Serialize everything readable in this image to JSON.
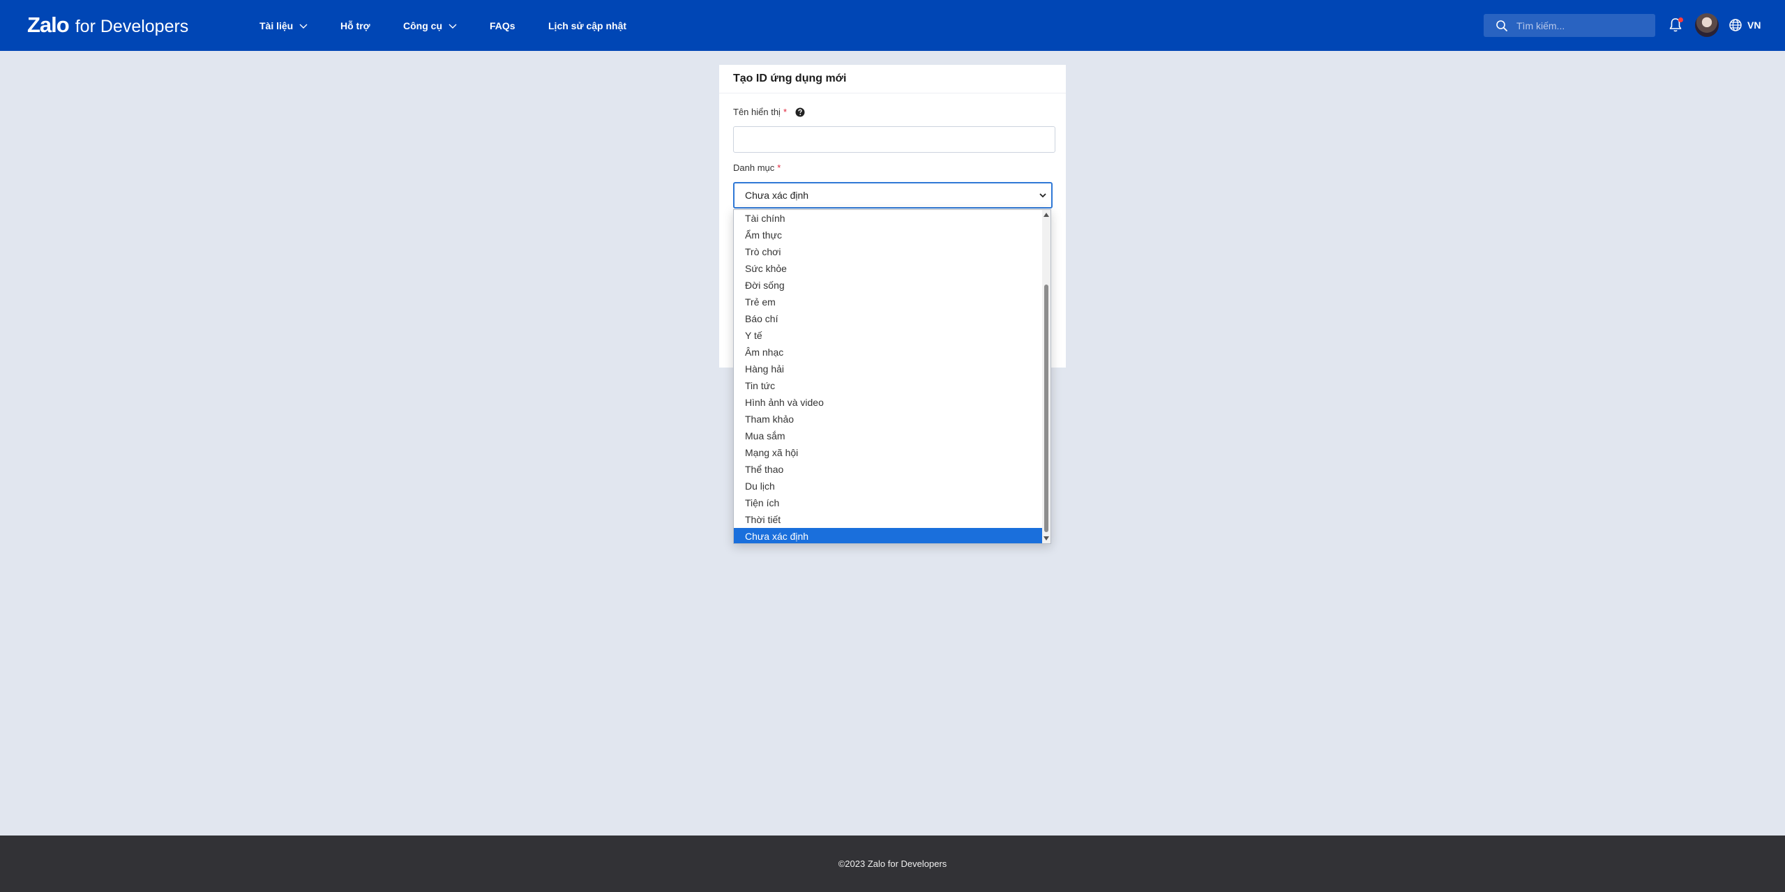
{
  "header": {
    "brand": "Zalo",
    "brand_suffix": "for Developers",
    "nav": [
      {
        "label": "Tài liệu",
        "has_dropdown": true
      },
      {
        "label": "Hỗ trợ",
        "has_dropdown": false
      },
      {
        "label": "Công cụ",
        "has_dropdown": true
      },
      {
        "label": "FAQs",
        "has_dropdown": false
      },
      {
        "label": "Lịch sử cập nhật",
        "has_dropdown": false
      }
    ],
    "search_placeholder": "Tìm kiếm...",
    "language": "VN"
  },
  "form": {
    "title": "Tạo ID ứng dụng mới",
    "display_name_label": "Tên hiển thị",
    "required_mark": "*",
    "display_name_value": "",
    "category_label": "Danh mục",
    "category_value": "Chưa xác định"
  },
  "dropdown": {
    "options": [
      "Tài chính",
      "Ẩm thực",
      "Trò chơi",
      "Sức khỏe",
      "Đời sống",
      "Trẻ em",
      "Báo chí",
      "Y tế",
      "Âm nhạc",
      "Hàng hải",
      "Tin tức",
      "Hình ảnh và video",
      "Tham khảo",
      "Mua sắm",
      "Mạng xã hội",
      "Thể thao",
      "Du lịch",
      "Tiện ích",
      "Thời tiết",
      "Chưa xác định"
    ],
    "selected_index": 19
  },
  "footer": {
    "copyright": "©2023 Zalo for Developers"
  },
  "colors": {
    "header_bg": "#0046b5",
    "page_bg": "#e1e6ef",
    "footer_bg": "#323236",
    "selected_option_bg": "#1a6fdc",
    "required": "#e0243a"
  }
}
